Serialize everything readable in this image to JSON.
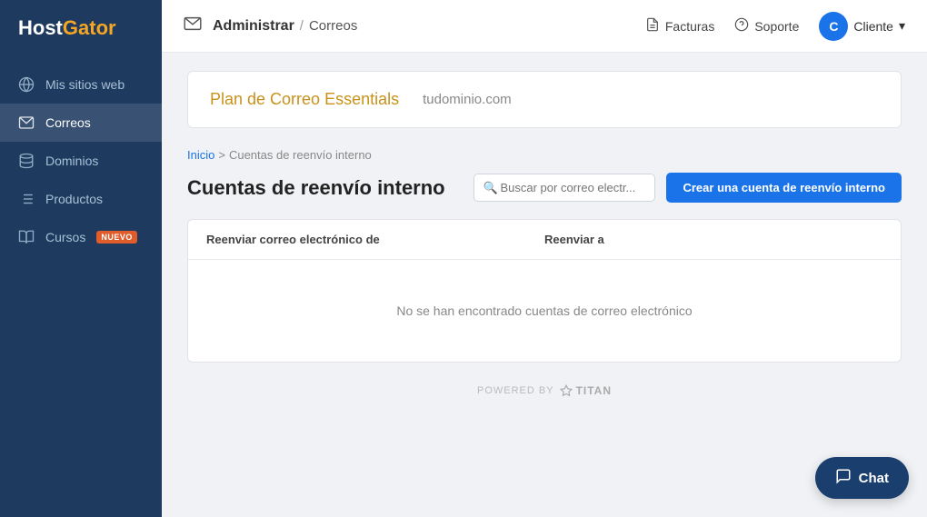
{
  "sidebar": {
    "logo": "HostGator",
    "logo_host": "Host",
    "logo_gator": "Gator",
    "items": [
      {
        "id": "mis-sitios",
        "label": "Mis sitios web",
        "icon": "globe",
        "active": false
      },
      {
        "id": "correos",
        "label": "Correos",
        "icon": "email",
        "active": true
      },
      {
        "id": "dominios",
        "label": "Dominios",
        "icon": "disk",
        "active": false
      },
      {
        "id": "productos",
        "label": "Productos",
        "icon": "list",
        "active": false
      },
      {
        "id": "cursos",
        "label": "Cursos",
        "icon": "book",
        "active": false,
        "badge": "NUEVO"
      }
    ]
  },
  "topbar": {
    "mail_icon": "✉",
    "admin_label": "Administrar",
    "separator": "/",
    "correos_label": "Correos",
    "facturas_label": "Facturas",
    "soporte_label": "Soporte",
    "cliente_label": "Cliente",
    "avatar_letter": "C"
  },
  "plan": {
    "title": "Plan de Correo Essentials",
    "domain": "tudominio.com"
  },
  "breadcrumb": {
    "inicio": "Inicio",
    "separator": ">",
    "current": "Cuentas de reenvío interno"
  },
  "page": {
    "title": "Cuentas de reenvío interno",
    "search_placeholder": "Buscar por correo electr...",
    "create_button": "Crear una cuenta de reenvío interno"
  },
  "table": {
    "col_from": "Reenviar correo electrónico de",
    "col_to": "Reenviar a",
    "empty_message": "No se han encontrado cuentas de correo electrónico"
  },
  "footer": {
    "powered_by": "POWERED BY",
    "brand": "TITAN"
  },
  "chat": {
    "label": "Chat"
  }
}
